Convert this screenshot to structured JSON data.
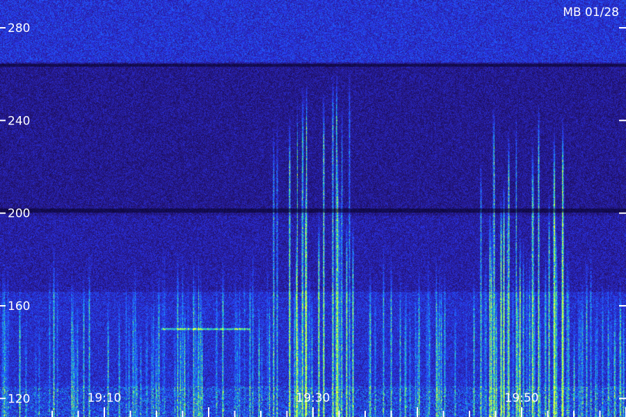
{
  "chart_data": {
    "type": "heatmap",
    "title": "MB 01/28",
    "xlabel": "",
    "ylabel": "",
    "x_ticks": [
      "19:10",
      "19:30",
      "19:50"
    ],
    "y_ticks": [
      120,
      160,
      200,
      240,
      280
    ],
    "ylim": [
      112,
      292
    ],
    "grid": false,
    "colors": {
      "background": "#1a1060",
      "low": "#2a1a8a",
      "mid": "#2040ff",
      "high": "#20c0c0",
      "peak": "#c0ff40"
    },
    "features": {
      "strong_vertical_bursts": [
        "19:30",
        "19:50"
      ],
      "horizontal_line_near": 150
    }
  }
}
